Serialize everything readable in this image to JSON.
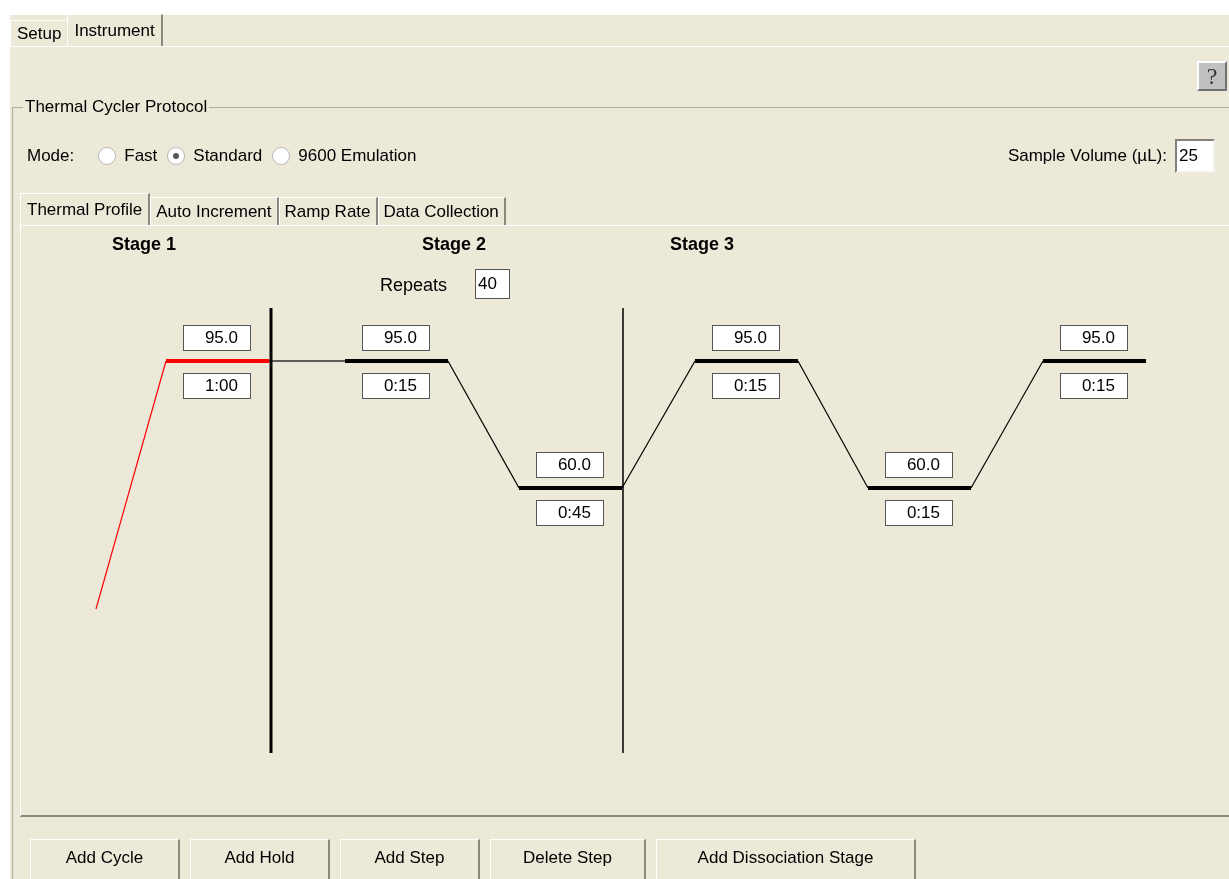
{
  "tabs": [
    {
      "label": "Setup",
      "selected": false
    },
    {
      "label": "Instrument",
      "selected": true
    }
  ],
  "help_button": "?",
  "protocol": {
    "title": "Thermal Cycler Protocol",
    "mode_label": "Mode:",
    "modes": [
      {
        "label": "Fast",
        "selected": false
      },
      {
        "label": "Standard",
        "selected": true
      },
      {
        "label": "9600 Emulation",
        "selected": false
      }
    ],
    "sample_volume": {
      "label": "Sample Volume (µL):",
      "value": "25"
    },
    "tabs": [
      {
        "label": "Thermal Profile",
        "selected": true
      },
      {
        "label": "Auto Increment",
        "selected": false
      },
      {
        "label": "Ramp Rate",
        "selected": false
      },
      {
        "label": "Data Collection",
        "selected": false
      }
    ],
    "stages": [
      {
        "title": "Stage 1",
        "steps": [
          {
            "temperature": "95.0",
            "time": "1:00",
            "selected": true
          }
        ]
      },
      {
        "title": "Stage 2",
        "repeats_label": "Repeats",
        "repeats": "40",
        "steps": [
          {
            "temperature": "95.0",
            "time": "0:15",
            "selected": false
          },
          {
            "temperature": "60.0",
            "time": "0:45",
            "selected": false
          }
        ]
      },
      {
        "title": "Stage 3",
        "steps": [
          {
            "temperature": "95.0",
            "time": "0:15",
            "selected": false
          },
          {
            "temperature": "60.0",
            "time": "0:15",
            "selected": false
          },
          {
            "temperature": "95.0",
            "time": "0:15",
            "selected": false
          }
        ]
      }
    ],
    "buttons": [
      "Add Cycle",
      "Add Hold",
      "Add Step",
      "Delete Step",
      "Add Dissociation Stage"
    ]
  }
}
